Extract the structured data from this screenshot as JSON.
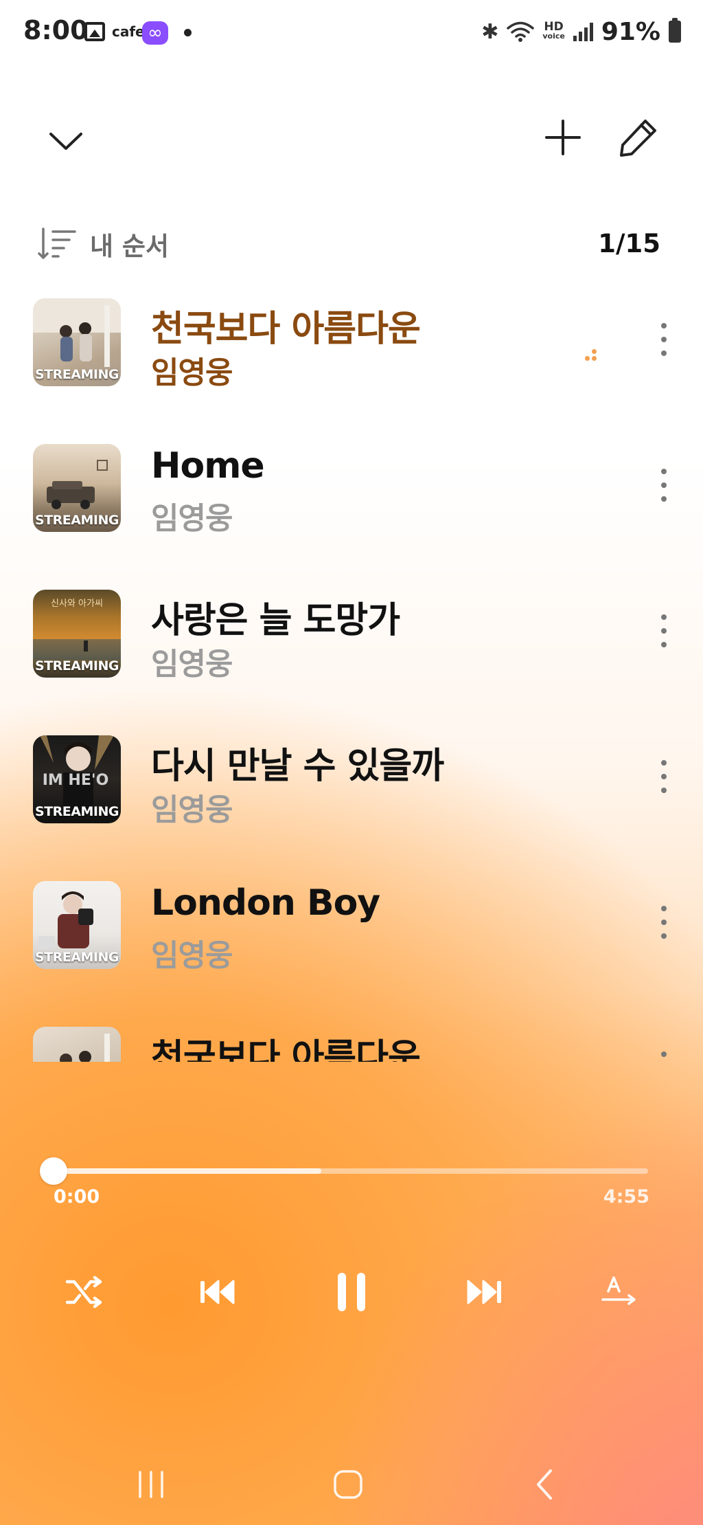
{
  "status_bar": {
    "time": "8:00",
    "cafe": "cafe",
    "battery": "91%",
    "hd_top": "HD",
    "hd_bottom": "voice"
  },
  "toolbar": {
    "collapse_icon": "chevron-down-icon",
    "add_icon": "plus-icon",
    "edit_icon": "pencil-icon"
  },
  "sort": {
    "label": "내 순서",
    "count": "1/15"
  },
  "tracks": [
    {
      "title": "천국보다 아름다운",
      "artist": "임영웅",
      "tag": "STREAMING",
      "playing": true
    },
    {
      "title": "Home",
      "artist": "임영웅",
      "tag": "STREAMING",
      "playing": false
    },
    {
      "title": "사랑은 늘 도망가",
      "artist": "임영웅",
      "tag": "STREAMING",
      "playing": false
    },
    {
      "title": "다시 만날 수 있을까",
      "artist": "임영웅",
      "tag": "STREAMING",
      "playing": false
    },
    {
      "title": "London Boy",
      "artist": "임영웅",
      "tag": "STREAMING",
      "playing": false
    },
    {
      "title": "천국보다 아름다운",
      "artist": "",
      "tag": "",
      "playing": false
    }
  ],
  "player": {
    "elapsed": "0:00",
    "total": "4:55",
    "progress_fraction": 0.0,
    "buffered_fraction": 0.45
  },
  "colors": {
    "current_track": "#8a4a10",
    "accent_orange": "#ff9a30",
    "artist_grey": "#9b9b9b"
  }
}
